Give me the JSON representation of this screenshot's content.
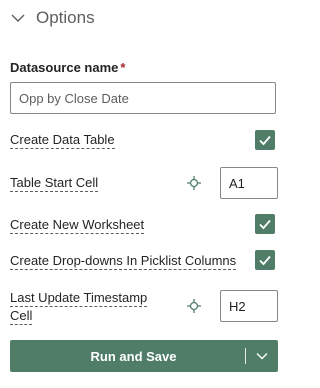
{
  "section": {
    "title": "Options",
    "chevron_icon": "chevron-down-icon"
  },
  "datasource": {
    "label": "Datasource name",
    "required_marker": "*",
    "value": "Opp by Close Date"
  },
  "options": {
    "create_data_table": {
      "label": "Create Data Table",
      "checked": true
    },
    "table_start_cell": {
      "label": "Table Start Cell",
      "value": "A1",
      "picker_icon": "crosshair-icon"
    },
    "create_new_worksheet": {
      "label": "Create New Worksheet",
      "checked": true
    },
    "create_dropdowns": {
      "label": "Create Drop-downs In Picklist Columns",
      "checked": true
    },
    "last_update_timestamp": {
      "label_line1": "Last Update Timestamp",
      "label_line2": "Cell",
      "value": "H2",
      "picker_icon": "crosshair-icon"
    }
  },
  "run_button": {
    "label": "Run and Save",
    "dropdown_icon": "chevron-down-icon"
  },
  "colors": {
    "accent": "#4f7d68",
    "required": "#a4262c",
    "text": "#252423",
    "muted": "#605e5c"
  }
}
